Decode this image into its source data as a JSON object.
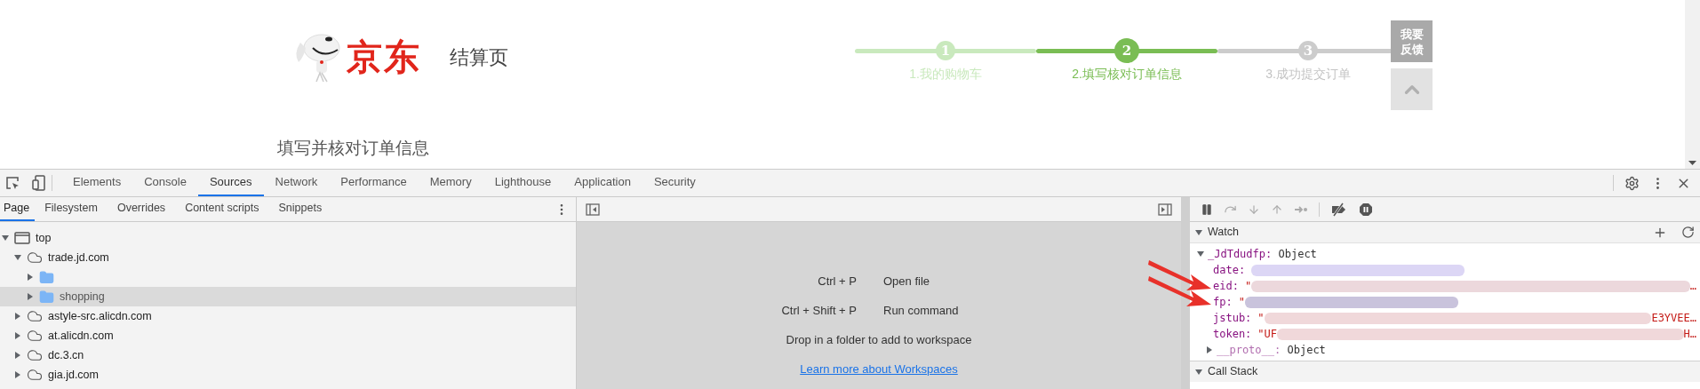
{
  "page": {
    "logo_text": "京东",
    "logo_subtitle": "结算页",
    "heading": "填写并核对订单信息",
    "steps": [
      {
        "number": "1",
        "label": "1.我的购物车",
        "completed": true,
        "selected": false
      },
      {
        "number": "2",
        "label": "2.填写核对订单信息",
        "completed": false,
        "selected": true
      },
      {
        "number": "3",
        "label": "3.成功提交订单",
        "completed": false,
        "selected": false
      }
    ],
    "feedback_lines": [
      "我要",
      "反馈"
    ]
  },
  "devtools": {
    "tabs": [
      {
        "label": "Elements",
        "selected": false
      },
      {
        "label": "Console",
        "selected": false
      },
      {
        "label": "Sources",
        "selected": true
      },
      {
        "label": "Network",
        "selected": false
      },
      {
        "label": "Performance",
        "selected": false
      },
      {
        "label": "Memory",
        "selected": false
      },
      {
        "label": "Lighthouse",
        "selected": false
      },
      {
        "label": "Application",
        "selected": false
      },
      {
        "label": "Security",
        "selected": false
      }
    ],
    "subtabs": [
      {
        "label": "Page",
        "selected": true
      },
      {
        "label": "Filesystem",
        "selected": false
      },
      {
        "label": "Overrides",
        "selected": false
      },
      {
        "label": "Content scripts",
        "selected": false
      },
      {
        "label": "Snippets",
        "selected": false
      }
    ],
    "tree": [
      {
        "kind": "frame",
        "label": "top",
        "expanded": true,
        "selected": false,
        "children": [
          {
            "kind": "domain",
            "label": "trade.jd.com",
            "expanded": true,
            "selected": false,
            "children": [
              {
                "kind": "folder",
                "expanded": false,
                "selected": false
              },
              {
                "kind": "folder",
                "label": "shopping",
                "expanded": false,
                "selected": true
              }
            ]
          },
          {
            "kind": "domain",
            "label": "astyle-src.alicdn.com",
            "expanded": false,
            "selected": false
          },
          {
            "kind": "domain",
            "label": "at.alicdn.com",
            "expanded": false,
            "selected": false
          },
          {
            "kind": "domain",
            "label": "dc.3.cn",
            "expanded": false,
            "selected": false
          },
          {
            "kind": "domain",
            "label": "gia.jd.com",
            "expanded": false,
            "selected": false
          }
        ]
      }
    ],
    "workspace_hints": [
      {
        "shortcut": "Ctrl + P",
        "action": "Open file"
      },
      {
        "shortcut": "Ctrl + Shift + P",
        "action": "Run command"
      }
    ],
    "drop_text": "Drop in a folder to add to workspace",
    "workspace_link": "Learn more about Workspaces",
    "watch": {
      "title": "Watch",
      "expression": {
        "name": "_JdTdudfp:",
        "value": "Object",
        "expanded": true,
        "properties": [
          {
            "name": "date:",
            "color": "#dcd6f5",
            "arrow": false
          },
          {
            "name": "eid:",
            "prefix": "\"",
            "color": "#ecd8dc",
            "tail": "…",
            "arrow": true
          },
          {
            "name": "fp:",
            "prefix": "\"",
            "color": "#c9c3dc",
            "arrow": true
          },
          {
            "name": "jstub:",
            "prefix": "\"",
            "color": "#f0d8da",
            "tail": "E3YVEE…",
            "arrow": false
          },
          {
            "name": "token:",
            "prefix": "\"UF",
            "color": "#f0d8da",
            "tail": "H…",
            "arrow": false
          }
        ],
        "proto": {
          "name": "__proto__:",
          "value": "Object",
          "expanded": false
        }
      }
    },
    "call_stack_title": "Call Stack"
  }
}
